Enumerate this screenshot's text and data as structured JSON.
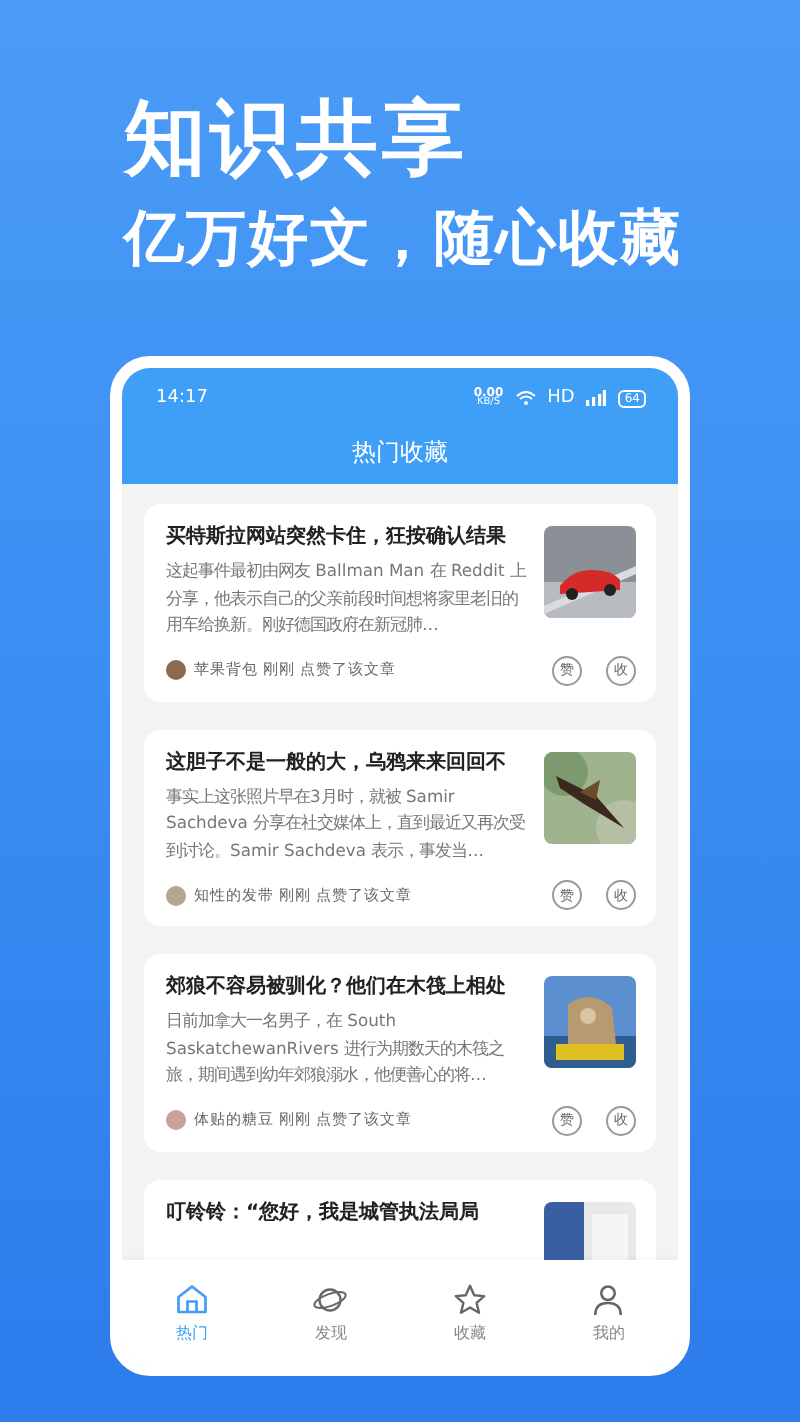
{
  "hero": {
    "title": "知识共享",
    "subtitle": "亿万好文，随心收藏"
  },
  "status_bar": {
    "time": "14:17",
    "speed": "0.00",
    "speed_unit": "KB/S",
    "network": "HD",
    "battery": "64"
  },
  "header": {
    "title": "热门收藏"
  },
  "articles": [
    {
      "title": "买特斯拉网站突然卡住，狂按确认结果",
      "summary": "这起事件最初由网友 Ballman Man 在 Reddit 上分享，他表示自己的父亲前段时间想将家里老旧的用车给换新。刚好德国政府在新冠肺…",
      "user": "苹果背包",
      "time": "刚刚",
      "action": "点赞了该文章",
      "like": "赞",
      "collect": "收"
    },
    {
      "title": "这胆子不是一般的大，乌鸦来来回回不",
      "summary": "事实上这张照片早在3月时，就被 Samir Sachdeva 分享在社交媒体上，直到最近又再次受到讨论。Samir Sachdeva 表示，事发当…",
      "user": "知性的发带",
      "time": "刚刚",
      "action": "点赞了该文章",
      "like": "赞",
      "collect": "收"
    },
    {
      "title": "郊狼不容易被驯化？他们在木筏上相处",
      "summary": "日前加拿大一名男子，在 South SaskatchewanRivers 进行为期数天的木筏之旅，期间遇到幼年郊狼溺水，他便善心的将…",
      "user": "体贴的糖豆",
      "time": "刚刚",
      "action": "点赞了该文章",
      "like": "赞",
      "collect": "收"
    },
    {
      "title": "叮铃铃：“您好，我是城管执法局局"
    }
  ],
  "tabs": [
    {
      "label": "热门",
      "selected": true
    },
    {
      "label": "发现",
      "selected": false
    },
    {
      "label": "收藏",
      "selected": false
    },
    {
      "label": "我的",
      "selected": false
    }
  ]
}
